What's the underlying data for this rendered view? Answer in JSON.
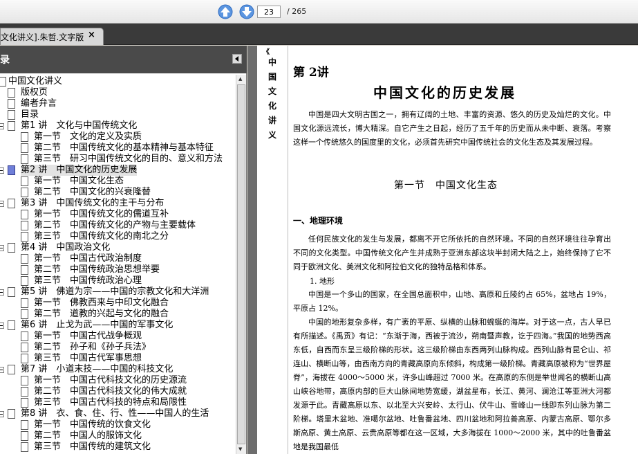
{
  "toolbar": {
    "page_current": "23",
    "page_total": "/ 265",
    "up_icon": "arrow-up-icon",
    "down_icon": "arrow-down-icon"
  },
  "tab": {
    "label": "文化讲义].朱哲.文字版",
    "close": "×"
  },
  "panel": {
    "title": "录"
  },
  "tree": [
    {
      "label": "中国文化讲义",
      "level": 0,
      "expander": true
    },
    {
      "label": "版权页",
      "level": 1
    },
    {
      "label": "编者弁言",
      "level": 1
    },
    {
      "label": "目录",
      "level": 1
    },
    {
      "label": "第1 讲　文化与中国传统文化",
      "level": 1,
      "expander": true
    },
    {
      "label": "第一节　文化的定义及实质",
      "level": 2
    },
    {
      "label": "第二节　中国传统文化的基本精神与基本特征",
      "level": 2
    },
    {
      "label": "第三节　研习中国传统文化的目的、意义和方法",
      "level": 2
    },
    {
      "label": "第2 讲　中国文化的历史发展",
      "level": 1,
      "expander": true,
      "selected": true
    },
    {
      "label": "第一节　中国文化生态",
      "level": 2
    },
    {
      "label": "第二节　中国文化的兴衰隆替",
      "level": 2
    },
    {
      "label": "第3 讲　中国传统文化的主干与分布",
      "level": 1,
      "expander": true
    },
    {
      "label": "第一节　中国传统文化的儒道互补",
      "level": 2
    },
    {
      "label": "第二节　中国传统文化的产物与主要载体",
      "level": 2
    },
    {
      "label": "第三节　中国传统文化的南北之分",
      "level": 2
    },
    {
      "label": "第4 讲　中国政治文化",
      "level": 1,
      "expander": true
    },
    {
      "label": "第一节　中国古代政治制度",
      "level": 2
    },
    {
      "label": "第二节　中国传统政治思想举要",
      "level": 2
    },
    {
      "label": "第三节　中国传统政治心理",
      "level": 2
    },
    {
      "label": "第5 讲　佛道为宗——中国的宗教文化和大洋洲",
      "level": 1,
      "expander": true
    },
    {
      "label": "第一节　佛教西来与中印文化融合",
      "level": 2
    },
    {
      "label": "第二节　道教的兴起与文化的融合",
      "level": 2
    },
    {
      "label": "第6 讲　止戈为武——中国的军事文化",
      "level": 1,
      "expander": true
    },
    {
      "label": "第一节　中国古代战争概观",
      "level": 2
    },
    {
      "label": "第二节　孙子和《孙子兵法》",
      "level": 2
    },
    {
      "label": "第三节　中国古代军事思想",
      "level": 2
    },
    {
      "label": "第7 讲　小道末技——中国的科技文化",
      "level": 1,
      "expander": true
    },
    {
      "label": "第一节　中国古代科技文化的历史源流",
      "level": 2
    },
    {
      "label": "第二节　中国古代科技文化的伟大成就",
      "level": 2
    },
    {
      "label": "第三节　中国古代科技的特点和局限性",
      "level": 2
    },
    {
      "label": "第8 讲　衣、食、住、行、性——中国人的生活",
      "level": 1,
      "expander": true
    },
    {
      "label": "第一节　中国传统的饮食文化",
      "level": 2
    },
    {
      "label": "第二节　中国人的服饰文化",
      "level": 2
    },
    {
      "label": "第三节　中国传统的建筑文化",
      "level": 2
    }
  ],
  "document": {
    "side_title": [
      "中",
      "国",
      "文",
      "化",
      "讲",
      "义"
    ],
    "top_mark": "《",
    "chapter_label": "第 2讲",
    "chapter_title": "中国文化的历史发展",
    "intro": "中国是四大文明古国之一，拥有辽阔的土地、丰富的资源、悠久的历史及灿烂的文化。中国文化源远流长，博大精深。自它产生之日起，经历了五千年的历史而从未中断、衰落。考察这样一个传统悠久的国度里的文化，必须首先研究中国传统社会的文化生态及其发展过程。",
    "section_title": "第一节　中国文化生态",
    "sub_title": "一、地理环境",
    "para1": "任何民族文化的发生与发展，都离不开它所依托的自然环境。不同的自然环境往往孕育出不同的文化类型。中国传统文化产生并成熟于亚洲东部这块半封闭大陆之上，始终保持了它不同于欧洲文化、美洲文化和阿拉伯文化的独特品格和体系。",
    "point1": "1. 地形",
    "para2": "中国是一个多山的国家，在全国总面积中，山地、高原和丘陵约占 65%，盆地占 19%，平原占 12%。",
    "para3": "中国的地形复杂多样，有广袤的平原、纵横的山脉和蜿蜒的海岸。对于这一点，古人早已有所描述。《禹贡》有记：“东渐于海，西被于流沙，朔南暨声教，讫于四海。”我国的地势西高东低，自西而东呈三级阶梯的形状。这三级阶梯由东西两列山脉构成。西列山脉有昆仑山、祁连山、横断山等，由西南方向的青藏高原向东倾斜，构成第一级阶梯。青藏高原被称为“世界屋脊”，海拔在 4000～5000 米，许多山峰超过 7000 米。在高原的东侧是举世闻名的横断山高山峡谷地带，高原内部的巨大山脉间地势宽缓，湖盆星布，长江、黄河、澜沧江等亚洲大河都发源于此。青藏高原以东、以北至大兴安岭、太行山、伏牛山、雪峰山一线即东列山脉为第二阶梯。塔里木盆地、准噶尔盆地、吐鲁番盆地、四川盆地和阿拉善高原、内蒙古高原、鄂尔多斯高原、黄土高原、云贵高原等都在这一区域，大多海拔在 1000～2000 米，其中的吐鲁番盆地是我国最低"
  }
}
